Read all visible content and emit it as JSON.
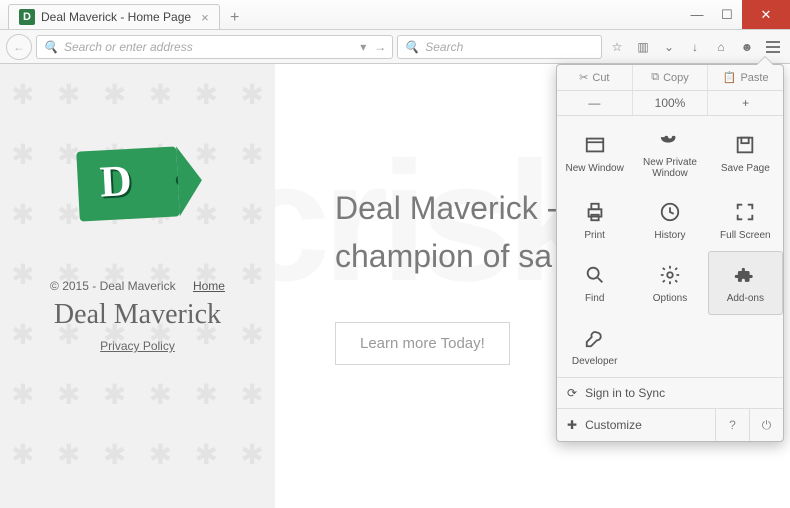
{
  "window": {
    "tab_title": "Deal Maverick - Home Page"
  },
  "toolbar": {
    "url_placeholder": "Search or enter address",
    "search_placeholder": "Search"
  },
  "sidebar": {
    "logo_letter": "D",
    "copyright": "© 2015 - Deal Maverick",
    "home_link": "Home",
    "brand": "Deal Maverick",
    "privacy_link": "Privacy Policy"
  },
  "main": {
    "headline_l1": "Deal Maverick -",
    "headline_l2": "champion of sa",
    "cta": "Learn more Today!"
  },
  "menu": {
    "cut": "Cut",
    "copy": "Copy",
    "paste": "Paste",
    "zoom_out": "—",
    "zoom_value": "100%",
    "zoom_in": "+",
    "items": [
      {
        "label": "New Window"
      },
      {
        "label": "New Private Window"
      },
      {
        "label": "Save Page"
      },
      {
        "label": "Print"
      },
      {
        "label": "History"
      },
      {
        "label": "Full Screen"
      },
      {
        "label": "Find"
      },
      {
        "label": "Options"
      },
      {
        "label": "Add-ons"
      },
      {
        "label": "Developer"
      }
    ],
    "sign_in": "Sign in to Sync",
    "customize": "Customize"
  }
}
